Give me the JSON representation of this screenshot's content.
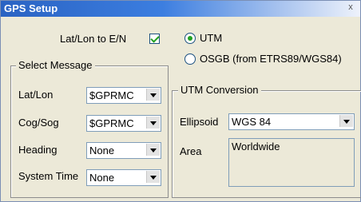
{
  "window": {
    "title": "GPS Setup",
    "close_glyph": "x"
  },
  "latlon_toggle": {
    "label": "Lat/Lon to E/N",
    "checked": true
  },
  "projection": {
    "utm_label": "UTM",
    "osgb_label": "OSGB (from ETRS89/WGS84)",
    "selected": "UTM"
  },
  "select_message": {
    "title": "Select Message",
    "rows": [
      {
        "label": "Lat/Lon",
        "value": "$GPRMC"
      },
      {
        "label": "Cog/Sog",
        "value": "$GPRMC"
      },
      {
        "label": "Heading",
        "value": "None"
      },
      {
        "label": "System Time",
        "value": "None"
      }
    ]
  },
  "utm_conversion": {
    "title": "UTM Conversion",
    "ellipsoid_label": "Ellipsoid",
    "ellipsoid_value": "WGS 84",
    "area_label": "Area",
    "area_value": "Worldwide"
  }
}
